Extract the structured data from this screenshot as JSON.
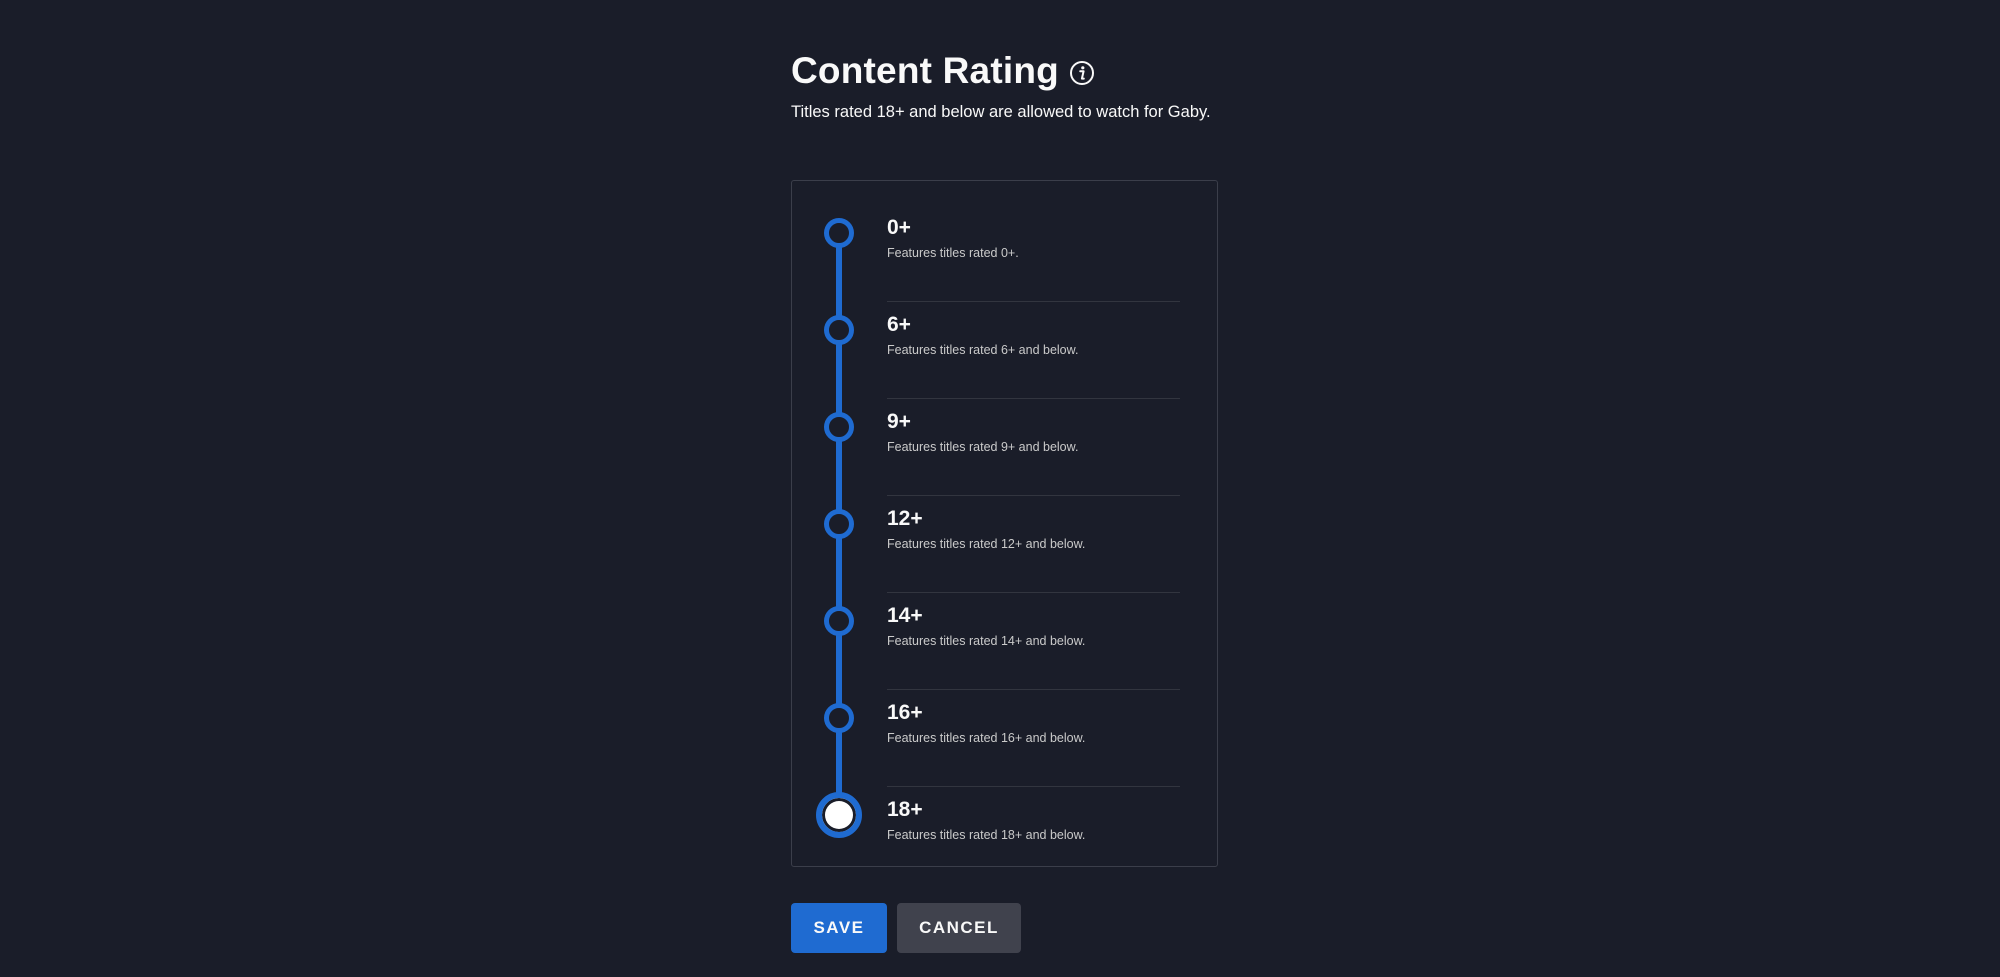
{
  "header": {
    "title": "Content Rating",
    "subtitle": "Titles rated 18+ and below are allowed to watch for Gaby."
  },
  "icons": {
    "info": "info-icon"
  },
  "ratings": [
    {
      "label": "0+",
      "description": "Features titles rated 0+."
    },
    {
      "label": "6+",
      "description": "Features titles rated 6+ and below."
    },
    {
      "label": "9+",
      "description": "Features titles rated 9+ and below."
    },
    {
      "label": "12+",
      "description": "Features titles rated 12+ and below."
    },
    {
      "label": "14+",
      "description": "Features titles rated 14+ and below."
    },
    {
      "label": "16+",
      "description": "Features titles rated 16+ and below."
    },
    {
      "label": "18+",
      "description": "Features titles rated 18+ and below."
    }
  ],
  "selected_rating": "18+",
  "buttons": {
    "save": "SAVE",
    "cancel": "CANCEL"
  },
  "colors": {
    "background": "#1a1d29",
    "accent": "#1f6bd1",
    "cancel_button": "#40424d"
  }
}
